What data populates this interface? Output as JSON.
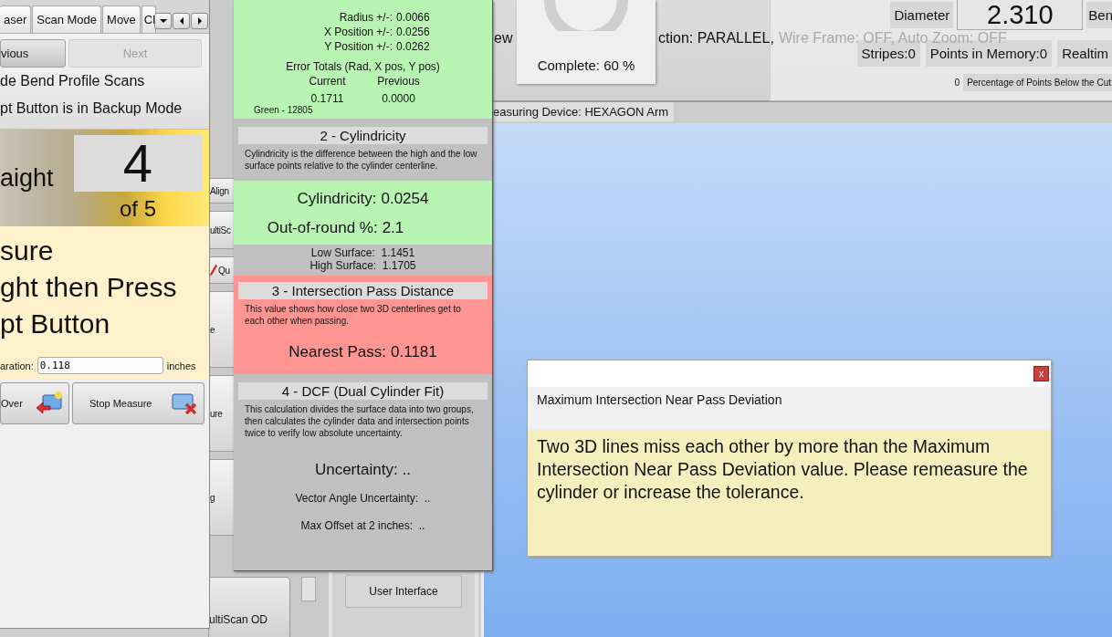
{
  "background_app": {
    "side_buttons": [
      {
        "label": "Align",
        "kind": "small"
      },
      {
        "label": "ultiSc",
        "kind": "tall"
      },
      {
        "label": "Qu",
        "kind": "tool"
      },
      {
        "label": "e",
        "kind": "big"
      },
      {
        "label": "ure",
        "kind": "big"
      },
      {
        "label": "g",
        "kind": "big"
      }
    ],
    "bottom_button": "ultiScan OD",
    "status_line": {
      "prefix": "ew",
      "main": "ction: PARALLEL,",
      "dimmed": "Wire Frame: OFF, Auto Zoom: OFF"
    },
    "device_label": "easuring Device: HEXAGON Arm",
    "user_interface_button": "User Interface"
  },
  "progress_popup": {
    "label": "Complete: 60 %"
  },
  "measure_panel": {
    "diameter_label": "Diameter",
    "diameter_value": "2.310",
    "bend_label": "Ben",
    "counters": [
      "Stripes:0",
      "Points in Memory:0",
      "Realtim"
    ],
    "cut_value": "0",
    "cut_label": "Percentage of Points Below the Cut"
  },
  "left_window": {
    "tabs": [
      {
        "label": "aser",
        "selected": false
      },
      {
        "label": "Scan Mode",
        "selected": false
      },
      {
        "label": "Move",
        "selected": false
      },
      {
        "label": "Cl",
        "selected": false
      }
    ],
    "nav_buttons": [
      {
        "label": "vious",
        "disabled": false
      },
      {
        "label": "Next",
        "disabled": true
      }
    ],
    "notes": [
      "de Bend Profile Scans",
      "pt Button is in Backup Mode"
    ],
    "step": {
      "label": "aight",
      "number": "4",
      "total": "of 5"
    },
    "instructions": [
      "sure",
      "ght then Press",
      "pt Button"
    ],
    "separation": {
      "label": "aration:",
      "value": "0.118",
      "unit": "inches"
    },
    "actions": [
      {
        "label": "Over",
        "kind": "back"
      },
      {
        "label": "Stop Measure",
        "kind": "stop"
      }
    ]
  },
  "results_window": {
    "fit": {
      "color": "#b8f5b2",
      "rows": [
        {
          "label": "Radius +/-:",
          "value": "0.0066"
        },
        {
          "label": "X Position +/-:",
          "value": "0.0256"
        },
        {
          "label": "Y Position +/-:",
          "value": "0.0262"
        }
      ],
      "totals_title": "Error Totals (Rad, X pos, Y pos)",
      "columns": [
        "Current",
        "Previous"
      ],
      "totals": [
        "0.1711",
        "0.0000"
      ],
      "footer": "Green - 12805"
    },
    "sections": [
      {
        "header": "2 - Cylindricity",
        "description": "Cylindricity is the difference between the high and the low surface points relative to the cylinder centerline.",
        "color": "#b8f5b2",
        "results": [
          {
            "label": "Cylindricity:",
            "value": "0.0254"
          },
          {
            "label": "Out-of-round %:",
            "value": "2.1"
          }
        ],
        "details": [
          "Low Surface:  1.1451",
          "High Surface:  1.1705"
        ]
      },
      {
        "header": "3 - Intersection Pass Distance",
        "description": "This value shows how close two 3D centerlines get to each other when passing.",
        "color": "#ff9593",
        "results": [
          {
            "label": "Nearest Pass:",
            "value": "0.1181"
          }
        ]
      },
      {
        "header": "4 - DCF (Dual Cylinder Fit)",
        "description": "This calculation divides the surface data into two groups, then calculates the cylinder data and intersection points twice to verify low absolute uncertainty.",
        "results": [
          {
            "label": "Uncertainty:",
            "value": ".."
          }
        ],
        "details": [
          "Vector Angle Uncertainty:  ..",
          "Max Offset at 2 inches:  .."
        ]
      }
    ]
  },
  "dialog": {
    "close": "x",
    "heading": "Maximum Intersection Near Pass Deviation",
    "message": "Two 3D lines miss each other by more than the Maximum Intersection Near Pass Deviation value.  Please remeasure the cylinder or increase the tolerance."
  }
}
